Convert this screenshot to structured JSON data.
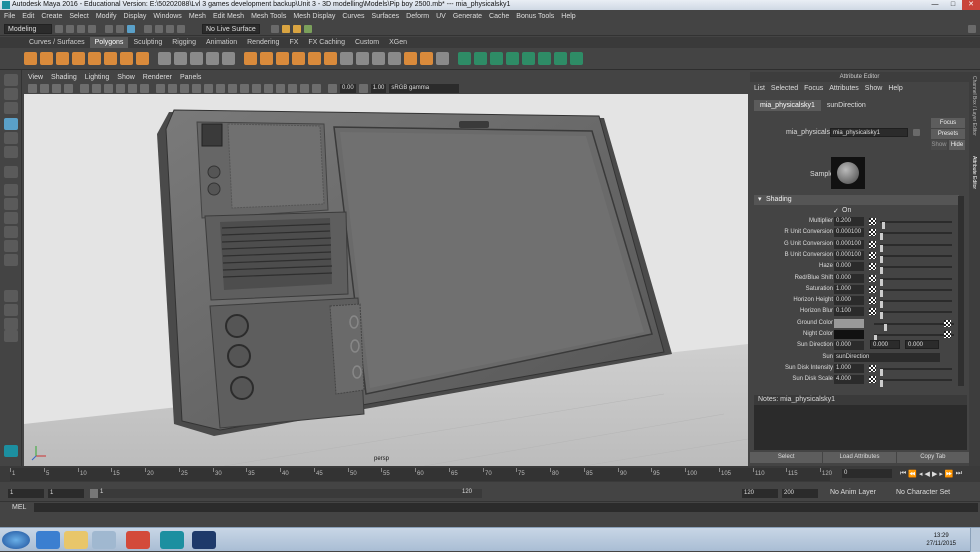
{
  "window": {
    "title": "Autodesk Maya 2016 - Educational Version: E:\\50202088\\Lvl 3 games development backup\\Unit 3 - 3D modelling\\Models\\Pip boy 2500.mb* --- mia_physicalsky1",
    "min": "—",
    "max": "□",
    "close": "✕"
  },
  "menus": [
    "File",
    "Edit",
    "Create",
    "Select",
    "Modify",
    "Display",
    "Windows",
    "Mesh",
    "Edit Mesh",
    "Mesh Tools",
    "Mesh Display",
    "Curves",
    "Surfaces",
    "Deform",
    "UV",
    "Generate",
    "Cache",
    "Bonus Tools",
    "Help"
  ],
  "status": {
    "mode": "Modeling",
    "live": "No Live Surface"
  },
  "shelf_tabs": [
    "Curves / Surfaces",
    "Polygons",
    "Sculpting",
    "Rigging",
    "Animation",
    "Rendering",
    "FX",
    "FX Caching",
    "Custom",
    "XGen"
  ],
  "shelf_active": "Polygons",
  "viewport": {
    "menus": [
      "View",
      "Shading",
      "Lighting",
      "Show",
      "Renderer",
      "Panels"
    ],
    "exposure": "0.00",
    "gamma": "1.00",
    "colorspace": "sRGB gamma",
    "camera": "persp"
  },
  "attr_editor": {
    "title": "Attribute Editor",
    "menus": [
      "List",
      "Selected",
      "Focus",
      "Attributes",
      "Show",
      "Help"
    ],
    "tabs": [
      "mia_physicalsky1",
      "sunDirection"
    ],
    "node_label": "mia_physicalsky:",
    "node_value": "mia_physicalsky1",
    "btn_focus": "Focus",
    "btn_presets": "Presets",
    "btn_show": "Show",
    "btn_hide": "Hide",
    "sample_label": "Sample",
    "section": "Shading",
    "on_label": "On",
    "on_check": "✓",
    "attrs": [
      {
        "label": "Multiplier",
        "value": "0.200"
      },
      {
        "label": "R Unit Conversion",
        "value": "0.000100"
      },
      {
        "label": "G Unit Conversion",
        "value": "0.000100"
      },
      {
        "label": "B Unit Conversion",
        "value": "0.000100"
      },
      {
        "label": "Haze",
        "value": "0.000"
      },
      {
        "label": "Red/Blue Shift",
        "value": "0.000"
      },
      {
        "label": "Saturation",
        "value": "1.000"
      },
      {
        "label": "Horizon Height",
        "value": "0.000"
      },
      {
        "label": "Horizon Blur",
        "value": "0.100"
      },
      {
        "label": "Ground Color",
        "value": ""
      },
      {
        "label": "Night Color",
        "value": ""
      },
      {
        "label": "Sun Direction",
        "value": "0.000"
      },
      {
        "label": "Sun",
        "value": "sunDirection"
      },
      {
        "label": "Sun Disk Intensity",
        "value": "1.000"
      },
      {
        "label": "Sun Disk Scale",
        "value": "4.000"
      }
    ],
    "sun_dir_y": "0.000",
    "sun_dir_z": "0.000",
    "notes": "Notes: mia_physicalsky1",
    "btn_select": "Select",
    "btn_load": "Load Attributes",
    "btn_copy": "Copy Tab"
  },
  "side_tabs": [
    "Channel Box / Layer Editor",
    "Attribute Editor"
  ],
  "timeline": {
    "ticks": [
      "1",
      "5",
      "10",
      "15",
      "20",
      "25",
      "30",
      "35",
      "40",
      "45",
      "50",
      "55",
      "60",
      "65",
      "70",
      "75",
      "80",
      "85",
      "90",
      "95",
      "100",
      "105",
      "110",
      "115",
      "120"
    ],
    "current": "0"
  },
  "range": {
    "start": "1",
    "start2": "1",
    "slider_start": "1",
    "slider_end": "120",
    "end1": "120",
    "end2": "200",
    "anim_layer": "No Anim Layer",
    "char_set": "No Character Set"
  },
  "cmd": {
    "label": "MEL"
  },
  "taskbar": {
    "time": "13:29",
    "date": "27/11/2015"
  },
  "colors": {
    "accent": "#5aa0c8",
    "bg": "#444444",
    "field": "#2b2b2b",
    "shelf_orange": "#d98a3b"
  }
}
